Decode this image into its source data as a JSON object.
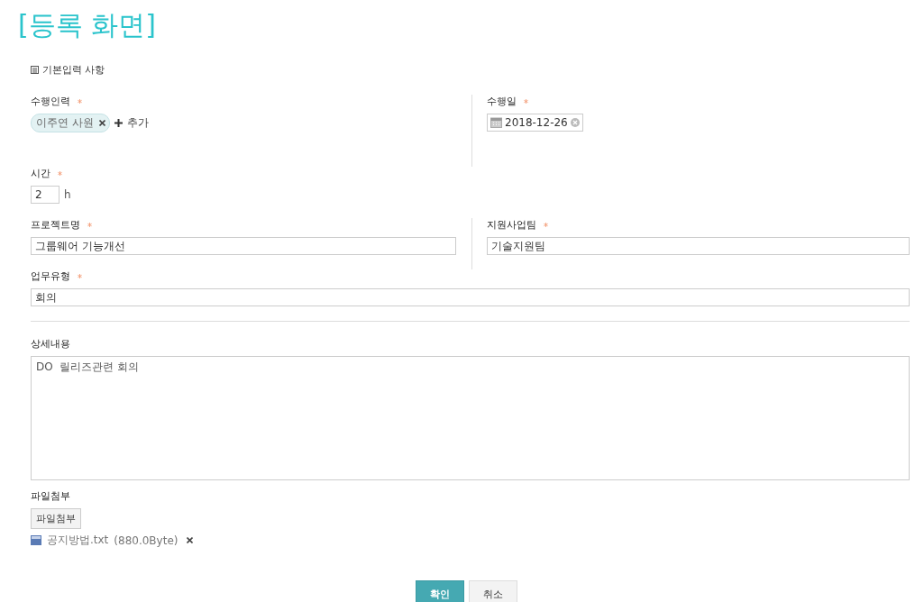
{
  "title": "[등록 화면]",
  "section_title": "기본입력 사항",
  "performer": {
    "label": "수행인력",
    "required": true,
    "tags": [
      {
        "name": "이주연 사원"
      }
    ],
    "add_label": "추가"
  },
  "date": {
    "label": "수행일",
    "required": true,
    "value": "2018-12-26"
  },
  "time": {
    "label": "시간",
    "required": true,
    "value": "2",
    "unit": "h"
  },
  "project": {
    "label": "프로젝트명",
    "required": true,
    "value": "그룹웨어 기능개선"
  },
  "support_team": {
    "label": "지원사업팀",
    "required": true,
    "value": "기술지원팀"
  },
  "work_type": {
    "label": "업무유형",
    "required": true,
    "value": "회의"
  },
  "details": {
    "label": "상세내용",
    "required": false,
    "value": "DO  릴리즈관련 회의"
  },
  "attachment": {
    "label": "파일첨부",
    "button": "파일첨부",
    "files": [
      {
        "name": "공지방법.txt",
        "size": "(880.0Byte)"
      }
    ]
  },
  "buttons": [
    {
      "label": "확인",
      "kind": "primary"
    },
    {
      "label": "취소",
      "kind": "secondary"
    }
  ]
}
